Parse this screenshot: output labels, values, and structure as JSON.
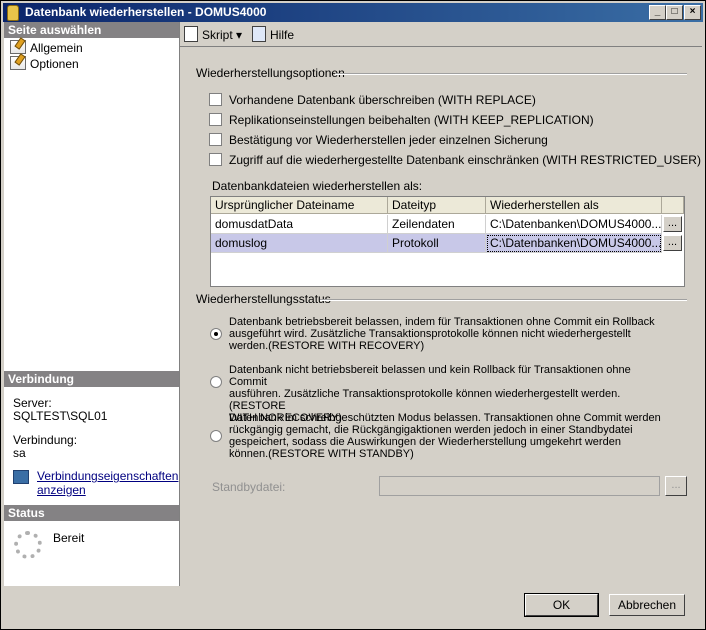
{
  "window": {
    "title": "Datenbank wiederherstellen - DOMUS4000"
  },
  "nav": {
    "header": "Seite auswählen",
    "items": [
      {
        "label": "Allgemein"
      },
      {
        "label": "Optionen"
      }
    ]
  },
  "connection": {
    "header": "Verbindung",
    "server_label": "Server:",
    "server_value": "SQLTEST\\SQL01",
    "conn_label": "Verbindung:",
    "conn_value": "sa",
    "link_line1": "Verbindungseigenschaften",
    "link_line2": "anzeigen"
  },
  "status": {
    "header": "Status",
    "value": "Bereit"
  },
  "toolbar": {
    "script_label": "Skript",
    "help_label": "Hilfe"
  },
  "options": {
    "group_title": "Wiederherstellungsoptionen",
    "checkboxes": [
      {
        "label": "Vorhandene Datenbank überschreiben (WITH REPLACE)",
        "checked": false
      },
      {
        "label": "Replikationseinstellungen beibehalten (WITH KEEP_REPLICATION)",
        "checked": false
      },
      {
        "label": "Bestätigung vor Wiederherstellen jeder einzelnen Sicherung",
        "checked": false
      },
      {
        "label": "Zugriff auf die wiederhergestellte Datenbank einschränken (WITH RESTRICTED_USER)",
        "checked": false
      }
    ],
    "files_label": "Datenbankdateien wiederherstellen als:",
    "columns": [
      "Ursprünglicher Dateiname",
      "Dateityp",
      "Wiederherstellen als"
    ],
    "rows": [
      {
        "name": "domusdatData",
        "type": "Zeilendaten",
        "restore_as": "C:\\Datenbanken\\DOMUS4000...."
      },
      {
        "name": "domuslog",
        "type": "Protokoll",
        "restore_as": "C:\\Datenbanken\\DOMUS4000...."
      }
    ],
    "ellipsis": "..."
  },
  "recovery": {
    "group_title": "Wiederherstellungsstatus",
    "selected": 0,
    "radios": [
      {
        "line1": "Datenbank betriebsbereit belassen, indem für Transaktionen ohne Commit ein Rollback",
        "line2": "ausgeführt wird. Zusätzliche Transaktionsprotokolle können nicht wiederhergestellt",
        "line3": "werden.(RESTORE WITH RECOVERY)",
        "line4": ""
      },
      {
        "line1": "Datenbank nicht betriebsbereit belassen und kein Rollback für Transaktionen ohne Commit",
        "line2": "ausführen. Zusätzliche Transaktionsprotokolle können wiederhergestellt werden.(RESTORE",
        "line3": "WITH NORECOVERY)",
        "line4": ""
      },
      {
        "line1": "Datenbank im schreibgeschützten Modus belassen. Transaktionen ohne Commit werden",
        "line2": "rückgängig gemacht, die Rückgängigaktionen werden jedoch in einer Standbydatei",
        "line3": "gespeichert, sodass die Auswirkungen der Wiederherstellung umgekehrt werden",
        "line4": "können.(RESTORE WITH STANDBY)"
      }
    ],
    "standby_label": "Standbydatei:",
    "standby_value": ""
  },
  "buttons": {
    "ok": "OK",
    "cancel": "Abbrechen"
  }
}
